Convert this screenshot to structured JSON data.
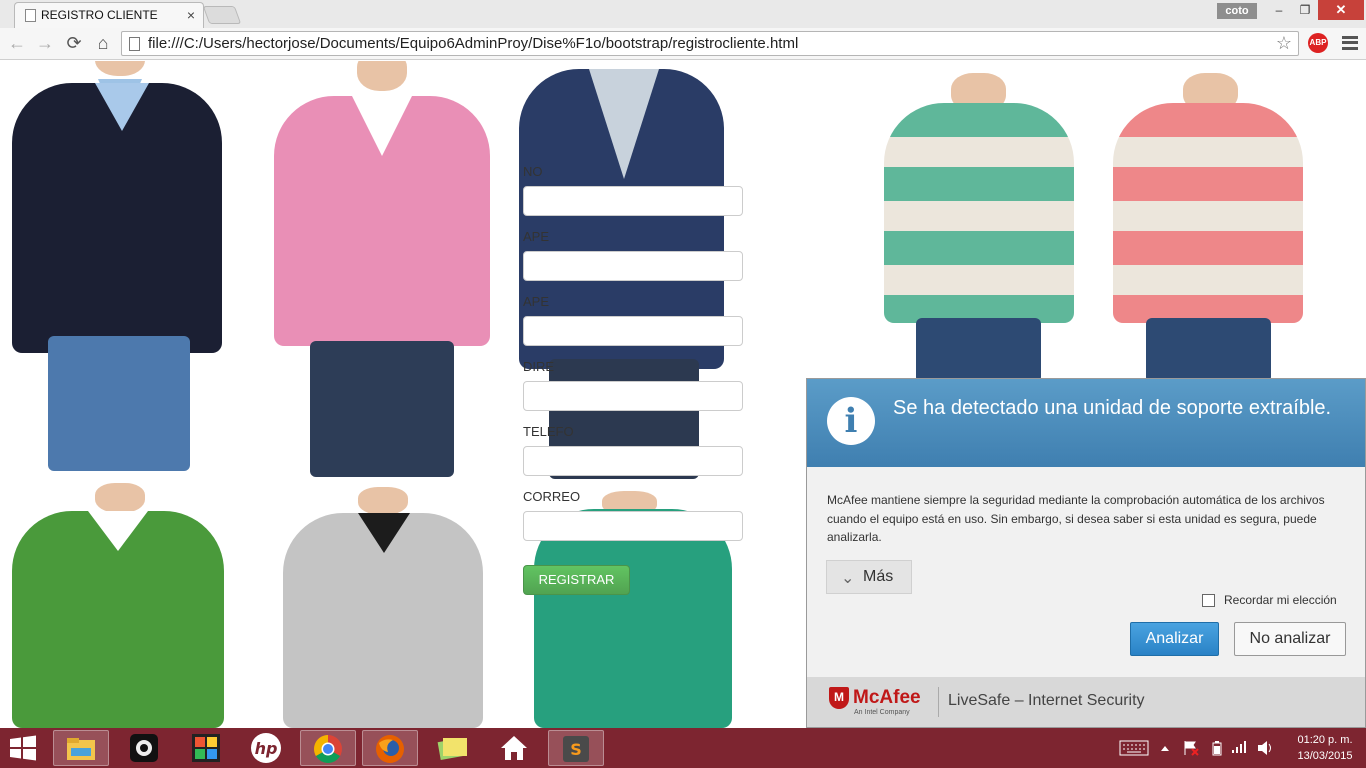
{
  "browser": {
    "tab_title": "REGISTRO CLIENTE",
    "tab_close": "×",
    "user": "coto",
    "minimize": "–",
    "restore": "❐",
    "close": "✕",
    "back": "←",
    "forward": "→",
    "reload": "⟳",
    "home": "⌂",
    "url": "file:///C:/Users/hectorjose/Documents/Equipo6AdminProy/Dise%F1o/bootstrap/registrocliente.html",
    "bookmark": "☆",
    "adblock": "ABP"
  },
  "form": {
    "labels": [
      "NO",
      "APE",
      "APE",
      "DIRE",
      "TELEFO",
      "CORREO"
    ],
    "submit_label": "REGISTRAR"
  },
  "mcafee": {
    "title": "Se ha detectado una unidad de soporte extraíble.",
    "info_glyph": "i",
    "body": "McAfee mantiene siempre la seguridad mediante la comprobación automática de los archivos cuando el equipo está en uso. Sin embargo, si desea saber si esta unidad es segura, puede analizarla.",
    "more_label": "Más",
    "more_chevron": "⌄",
    "remember_label": "Recordar mi elección",
    "remember_checked": false,
    "analyze_label": "Analizar",
    "no_analyze_label": "No analizar",
    "brand": "McAfee",
    "brand_glyph": "M",
    "brand_sub": "An Intel Company",
    "product": "LiveSafe – Internet Security"
  },
  "taskbar": {
    "time": "01:20 p. m.",
    "date": "13/03/2015",
    "items": [
      "file-explorer",
      "media-app",
      "tiles-app",
      "hp",
      "chrome",
      "firefox",
      "photos-app",
      "home-app",
      "sublime-text"
    ]
  },
  "colors": {
    "taskbar": "#7d2530",
    "mcafee_header": "#4a8bbd",
    "register_button": "#5cb85c"
  }
}
